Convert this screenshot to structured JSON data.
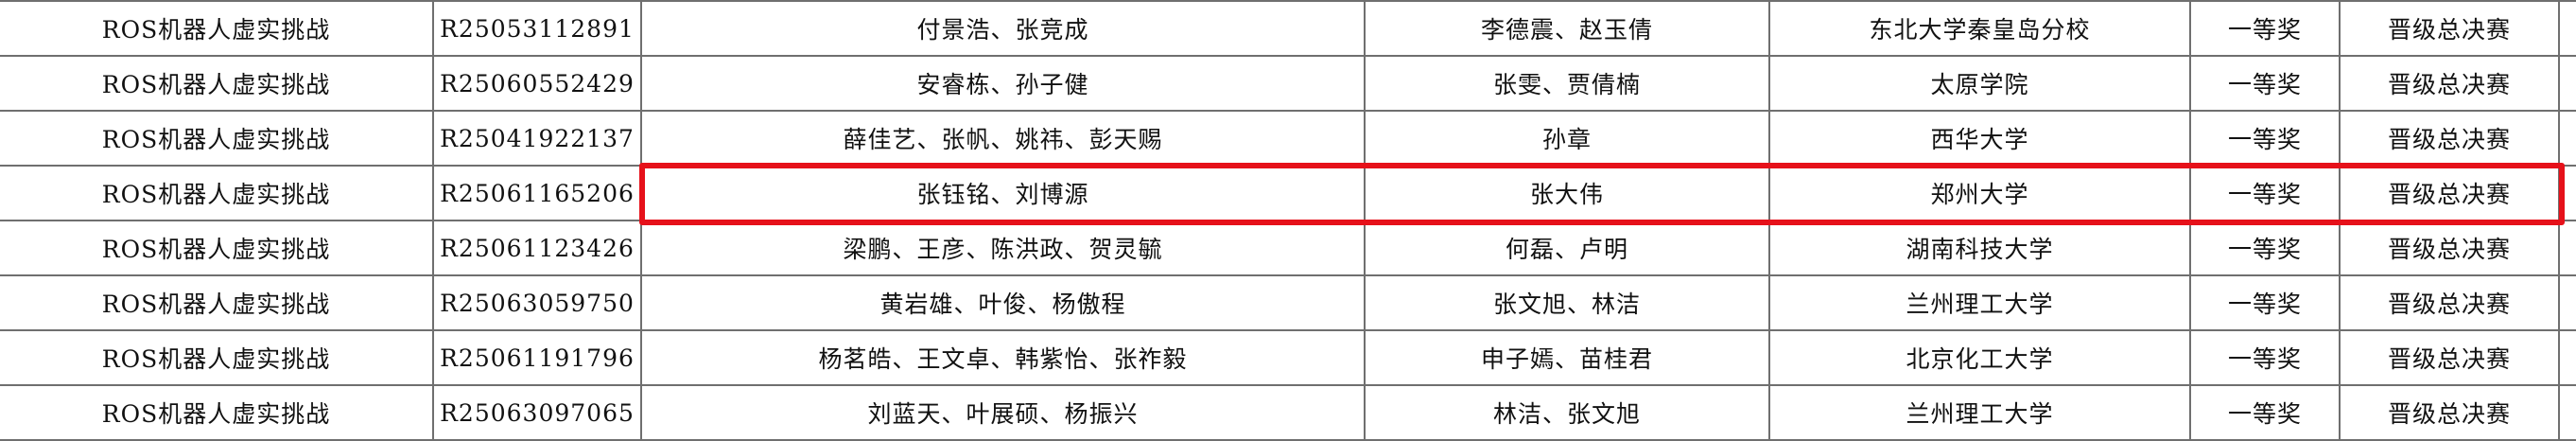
{
  "table": {
    "rows": [
      {
        "track": "ROS机器人虚实挑战",
        "code": "R25053112891",
        "students": "付景浩、张竞成",
        "advisors": "李德震、赵玉倩",
        "school": "东北大学秦皇岛分校",
        "award": "一等奖",
        "status": "晋级总决赛"
      },
      {
        "track": "ROS机器人虚实挑战",
        "code": "R25060552429",
        "students": "安睿栋、孙子健",
        "advisors": "张雯、贾倩楠",
        "school": "太原学院",
        "award": "一等奖",
        "status": "晋级总决赛"
      },
      {
        "track": "ROS机器人虚实挑战",
        "code": "R25041922137",
        "students": "薛佳艺、张帆、姚祎、彭天赐",
        "advisors": "孙章",
        "school": "西华大学",
        "award": "一等奖",
        "status": "晋级总决赛"
      },
      {
        "track": "ROS机器人虚实挑战",
        "code": "R25061165206",
        "students": "张钰铭、刘博源",
        "advisors": "张大伟",
        "school": "郑州大学",
        "award": "一等奖",
        "status": "晋级总决赛"
      },
      {
        "track": "ROS机器人虚实挑战",
        "code": "R25061123426",
        "students": "梁鹏、王彦、陈洪政、贺灵毓",
        "advisors": "何磊、卢明",
        "school": "湖南科技大学",
        "award": "一等奖",
        "status": "晋级总决赛"
      },
      {
        "track": "ROS机器人虚实挑战",
        "code": "R25063059750",
        "students": "黄岩雄、叶俊、杨傲程",
        "advisors": "张文旭、林洁",
        "school": "兰州理工大学",
        "award": "一等奖",
        "status": "晋级总决赛"
      },
      {
        "track": "ROS机器人虚实挑战",
        "code": "R25061191796",
        "students": "杨茗皓、王文卓、韩紫怡、张祚毅",
        "advisors": "申子嫣、苗桂君",
        "school": "北京化工大学",
        "award": "一等奖",
        "status": "晋级总决赛"
      },
      {
        "track": "ROS机器人虚实挑战",
        "code": "R25063097065",
        "students": "刘蓝天、叶展硕、杨振兴",
        "advisors": "林洁、张文旭",
        "school": "兰州理工大学",
        "award": "一等奖",
        "status": "晋级总决赛"
      }
    ]
  },
  "highlight": {
    "color": "#e6111a",
    "row_index": 3
  }
}
